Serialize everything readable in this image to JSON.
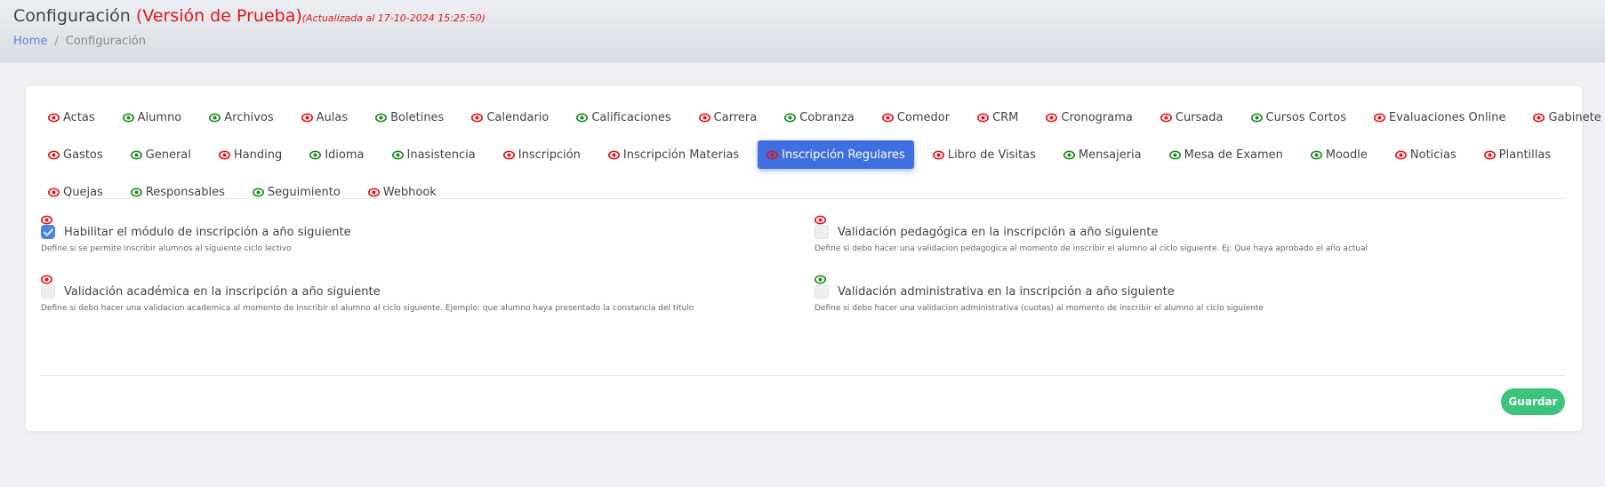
{
  "header": {
    "title": "Configuración",
    "version_label": "(Versión de Prueba)",
    "updated_label": "(Actualizada al 17-10-2024 15:25:50)",
    "breadcrumb": {
      "home": "Home",
      "separator": "/",
      "current": "Configuración"
    }
  },
  "colors": {
    "eye_red": "#e3151c",
    "eye_green": "#1e8a1e",
    "active_tab": "#3f6fe0",
    "save": "#3cc47c"
  },
  "tabs": {
    "row1": [
      {
        "label": "Actas",
        "eye": "red"
      },
      {
        "label": "Alumno",
        "eye": "green"
      },
      {
        "label": "Archivos",
        "eye": "green"
      },
      {
        "label": "Aulas",
        "eye": "red"
      },
      {
        "label": "Boletines",
        "eye": "green"
      },
      {
        "label": "Calendario",
        "eye": "red"
      },
      {
        "label": "Calificaciones",
        "eye": "green"
      },
      {
        "label": "Carrera",
        "eye": "red"
      },
      {
        "label": "Cobranza",
        "eye": "green"
      },
      {
        "label": "Comedor",
        "eye": "red"
      },
      {
        "label": "CRM",
        "eye": "red"
      },
      {
        "label": "Cronograma",
        "eye": "red"
      },
      {
        "label": "Cursada",
        "eye": "red"
      },
      {
        "label": "Cursos Cortos",
        "eye": "green"
      },
      {
        "label": "Evaluaciones Online",
        "eye": "red"
      },
      {
        "label": "Gabinete",
        "eye": "red"
      }
    ],
    "row2": [
      {
        "label": "Gastos",
        "eye": "red"
      },
      {
        "label": "General",
        "eye": "green"
      },
      {
        "label": "Handing",
        "eye": "red"
      },
      {
        "label": "Idioma",
        "eye": "green"
      },
      {
        "label": "Inasistencia",
        "eye": "green"
      },
      {
        "label": "Inscripción",
        "eye": "red"
      },
      {
        "label": "Inscripción Materias",
        "eye": "red"
      },
      {
        "label": "Inscripción Regulares",
        "eye": "red",
        "active": true
      },
      {
        "label": "Libro de Visitas",
        "eye": "red"
      },
      {
        "label": "Mensajeria",
        "eye": "green"
      },
      {
        "label": "Mesa de Examen",
        "eye": "green"
      },
      {
        "label": "Moodle",
        "eye": "green"
      },
      {
        "label": "Noticias",
        "eye": "red"
      },
      {
        "label": "Plantillas",
        "eye": "red"
      }
    ],
    "row3": [
      {
        "label": "Quejas",
        "eye": "red"
      },
      {
        "label": "Responsables",
        "eye": "green"
      },
      {
        "label": "Seguimiento",
        "eye": "green"
      },
      {
        "label": "Webhook",
        "eye": "red"
      }
    ]
  },
  "options": [
    {
      "label": "Habilitar el módulo de inscripción a año siguiente",
      "description": "Define si se permite inscribir alumnos al siguiente ciclo lectivo",
      "checked": true,
      "eye": "red"
    },
    {
      "label": "Validación pedagógica en la inscripción a año siguiente",
      "description": "Define si debo hacer una validacion pedagogica al momento de inscribir el alumno al ciclo siguiente. Ej: Que haya aprobado el año actual",
      "checked": false,
      "eye": "red"
    },
    {
      "label": "Validación académica en la inscripción a año siguiente",
      "description": "Define si debo hacer una validacion academica al momento de inscribir el alumno al ciclo siguiente. Ejemplo: que alumno haya presentado la constancia del titulo",
      "checked": false,
      "eye": "red"
    },
    {
      "label": "Validación administrativa en la inscripción a año siguiente",
      "description": "Define si debo hacer una validacion administrativa (cuotas) al momento de inscribir el alumno al ciclo siguiente",
      "checked": false,
      "eye": "green"
    }
  ],
  "actions": {
    "save_label": "Guardar"
  }
}
